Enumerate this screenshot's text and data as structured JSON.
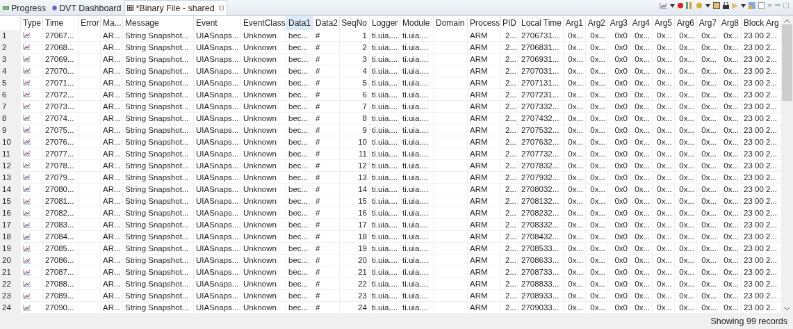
{
  "tabs": [
    {
      "label": "Progress",
      "selected": false,
      "kind": "progress"
    },
    {
      "label": "DVT Dashboard",
      "selected": false,
      "kind": "dashboard"
    },
    {
      "label": "*Binary File - shared",
      "selected": true,
      "kind": "table",
      "closable": true
    }
  ],
  "table": {
    "columns": [
      {
        "sorted": false
      },
      {
        "label": "Type",
        "sorted": false
      },
      {
        "label": "Time",
        "sorted": false
      },
      {
        "label": "Error",
        "sorted": false
      },
      {
        "label": "Ma...",
        "sorted": false
      },
      {
        "label": "Message",
        "sorted": false
      },
      {
        "label": "Event",
        "sorted": false
      },
      {
        "label": "EventClass",
        "sorted": false
      },
      {
        "label": "Data1",
        "sorted": true
      },
      {
        "label": "Data2",
        "sorted": false
      },
      {
        "label": "SeqNo",
        "sorted": false
      },
      {
        "label": "Logger",
        "sorted": false
      },
      {
        "label": "Module",
        "sorted": false
      },
      {
        "label": "Domain",
        "sorted": false
      },
      {
        "label": "Process",
        "sorted": false
      },
      {
        "label": "PID",
        "sorted": false
      },
      {
        "label": "Local Time",
        "sorted": false
      },
      {
        "label": "Arg1",
        "sorted": false
      },
      {
        "label": "Arg2",
        "sorted": false
      },
      {
        "label": "Arg3",
        "sorted": false
      },
      {
        "label": "Arg4",
        "sorted": false
      },
      {
        "label": "Arg5",
        "sorted": false
      },
      {
        "label": "Arg6",
        "sorted": false
      },
      {
        "label": "Arg7",
        "sorted": false
      },
      {
        "label": "Arg8",
        "sorted": false
      },
      {
        "label": "Block Arg",
        "sorted": false
      }
    ],
    "rows": [
      {
        "cells": [
          "1",
          "",
          "27067...",
          "",
          "AR...",
          "String Snapshot...",
          "UIASnaps...",
          "Unknown",
          "bec...",
          "#",
          "1",
          "ti.uia....",
          "ti.uia....",
          "",
          "ARM",
          "2...",
          "2706731...",
          "0x...",
          "0x...",
          "0x0",
          "0x...",
          "0x...",
          "0x...",
          "0x...",
          "0x...",
          "23 00 2..."
        ]
      },
      {
        "cells": [
          "2",
          "",
          "27068...",
          "",
          "AR...",
          "String Snapshot...",
          "UIASnaps...",
          "Unknown",
          "bec...",
          "#",
          "2",
          "ti.uia....",
          "ti.uia....",
          "",
          "ARM",
          "2...",
          "2706831...",
          "0x...",
          "0x...",
          "0x0",
          "0x...",
          "0x...",
          "0x...",
          "0x...",
          "0x...",
          "23 00 2..."
        ]
      },
      {
        "cells": [
          "3",
          "",
          "27069...",
          "",
          "AR...",
          "String Snapshot...",
          "UIASnaps...",
          "Unknown",
          "bec...",
          "#",
          "3",
          "ti.uia....",
          "ti.uia....",
          "",
          "ARM",
          "2...",
          "2706931...",
          "0x...",
          "0x...",
          "0x0",
          "0x...",
          "0x...",
          "0x...",
          "0x...",
          "0x...",
          "23 00 2..."
        ]
      },
      {
        "cells": [
          "4",
          "",
          "27070...",
          "",
          "AR...",
          "String Snapshot...",
          "UIASnaps...",
          "Unknown",
          "bec...",
          "#",
          "4",
          "ti.uia....",
          "ti.uia....",
          "",
          "ARM",
          "2...",
          "2707031...",
          "0x...",
          "0x...",
          "0x0",
          "0x...",
          "0x...",
          "0x...",
          "0x...",
          "0x...",
          "23 00 2..."
        ]
      },
      {
        "cells": [
          "5",
          "",
          "27071...",
          "",
          "AR...",
          "String Snapshot...",
          "UIASnaps...",
          "Unknown",
          "bec...",
          "#",
          "5",
          "ti.uia....",
          "ti.uia....",
          "",
          "ARM",
          "2...",
          "2707131...",
          "0x...",
          "0x...",
          "0x0",
          "0x...",
          "0x...",
          "0x...",
          "0x...",
          "0x...",
          "23 00 2..."
        ]
      },
      {
        "cells": [
          "6",
          "",
          "27072...",
          "",
          "AR...",
          "String Snapshot...",
          "UIASnaps...",
          "Unknown",
          "bec...",
          "#",
          "6",
          "ti.uia....",
          "ti.uia....",
          "",
          "ARM",
          "2...",
          "2707231...",
          "0x...",
          "0x...",
          "0x0",
          "0x...",
          "0x...",
          "0x...",
          "0x...",
          "0x...",
          "23 00 2..."
        ]
      },
      {
        "cells": [
          "7",
          "",
          "27073...",
          "",
          "AR...",
          "String Snapshot...",
          "UIASnaps...",
          "Unknown",
          "bec...",
          "#",
          "7",
          "ti.uia....",
          "ti.uia....",
          "",
          "ARM",
          "2...",
          "2707332...",
          "0x...",
          "0x...",
          "0x0",
          "0x...",
          "0x...",
          "0x...",
          "0x...",
          "0x...",
          "23 00 2..."
        ]
      },
      {
        "cells": [
          "8",
          "",
          "27074...",
          "",
          "AR...",
          "String Snapshot...",
          "UIASnaps...",
          "Unknown",
          "bec...",
          "#",
          "8",
          "ti.uia....",
          "ti.uia....",
          "",
          "ARM",
          "2...",
          "2707432...",
          "0x...",
          "0x...",
          "0x0",
          "0x...",
          "0x...",
          "0x...",
          "0x...",
          "0x...",
          "23 00 2..."
        ]
      },
      {
        "cells": [
          "9",
          "",
          "27075...",
          "",
          "AR...",
          "String Snapshot...",
          "UIASnaps...",
          "Unknown",
          "bec...",
          "#",
          "9",
          "ti.uia....",
          "ti.uia....",
          "",
          "ARM",
          "2...",
          "2707532...",
          "0x...",
          "0x...",
          "0x0",
          "0x...",
          "0x...",
          "0x...",
          "0x...",
          "0x...",
          "23 00 2..."
        ]
      },
      {
        "cells": [
          "10",
          "",
          "27076...",
          "",
          "AR...",
          "String Snapshot...",
          "UIASnaps...",
          "Unknown",
          "bec...",
          "#",
          "10",
          "ti.uia....",
          "ti.uia....",
          "",
          "ARM",
          "2...",
          "2707632...",
          "0x...",
          "0x...",
          "0x0",
          "0x...",
          "0x...",
          "0x...",
          "0x...",
          "0x...",
          "23 00 2..."
        ]
      },
      {
        "cells": [
          "11",
          "",
          "27077...",
          "",
          "AR...",
          "String Snapshot...",
          "UIASnaps...",
          "Unknown",
          "bec...",
          "#",
          "11",
          "ti.uia....",
          "ti.uia....",
          "",
          "ARM",
          "2...",
          "2707732...",
          "0x...",
          "0x...",
          "0x0",
          "0x...",
          "0x...",
          "0x...",
          "0x...",
          "0x...",
          "23 00 2..."
        ]
      },
      {
        "cells": [
          "12",
          "",
          "27078...",
          "",
          "AR...",
          "String Snapshot...",
          "UIASnaps...",
          "Unknown",
          "bec...",
          "#",
          "12",
          "ti.uia....",
          "ti.uia....",
          "",
          "ARM",
          "2...",
          "2707832...",
          "0x...",
          "0x...",
          "0x0",
          "0x...",
          "0x...",
          "0x...",
          "0x...",
          "0x...",
          "23 00 2..."
        ]
      },
      {
        "cells": [
          "13",
          "",
          "27079...",
          "",
          "AR...",
          "String Snapshot...",
          "UIASnaps...",
          "Unknown",
          "bec...",
          "#",
          "13",
          "ti.uia....",
          "ti.uia....",
          "",
          "ARM",
          "2...",
          "2707932...",
          "0x...",
          "0x...",
          "0x0",
          "0x...",
          "0x...",
          "0x...",
          "0x...",
          "0x...",
          "23 00 2..."
        ]
      },
      {
        "cells": [
          "14",
          "",
          "27080...",
          "",
          "AR...",
          "String Snapshot...",
          "UIASnaps...",
          "Unknown",
          "bec...",
          "#",
          "14",
          "ti.uia....",
          "ti.uia....",
          "",
          "ARM",
          "2...",
          "2708032...",
          "0x...",
          "0x...",
          "0x0",
          "0x...",
          "0x...",
          "0x...",
          "0x...",
          "0x...",
          "23 00 2..."
        ]
      },
      {
        "cells": [
          "15",
          "",
          "27081...",
          "",
          "AR...",
          "String Snapshot...",
          "UIASnaps...",
          "Unknown",
          "bec...",
          "#",
          "15",
          "ti.uia....",
          "ti.uia....",
          "",
          "ARM",
          "2...",
          "2708132...",
          "0x...",
          "0x...",
          "0x0",
          "0x...",
          "0x...",
          "0x...",
          "0x...",
          "0x...",
          "23 00 2..."
        ]
      },
      {
        "cells": [
          "16",
          "",
          "27082...",
          "",
          "AR...",
          "String Snapshot...",
          "UIASnaps...",
          "Unknown",
          "bec...",
          "#",
          "16",
          "ti.uia....",
          "ti.uia....",
          "",
          "ARM",
          "2...",
          "2708232...",
          "0x...",
          "0x...",
          "0x0",
          "0x...",
          "0x...",
          "0x...",
          "0x...",
          "0x...",
          "23 00 2..."
        ]
      },
      {
        "cells": [
          "17",
          "",
          "27083...",
          "",
          "AR...",
          "String Snapshot...",
          "UIASnaps...",
          "Unknown",
          "bec...",
          "#",
          "17",
          "ti.uia....",
          "ti.uia....",
          "",
          "ARM",
          "2...",
          "2708332...",
          "0x...",
          "0x...",
          "0x0",
          "0x...",
          "0x...",
          "0x...",
          "0x...",
          "0x...",
          "23 00 2..."
        ]
      },
      {
        "cells": [
          "18",
          "",
          "27084...",
          "",
          "AR...",
          "String Snapshot...",
          "UIASnaps...",
          "Unknown",
          "bec...",
          "#",
          "18",
          "ti.uia....",
          "ti.uia....",
          "",
          "ARM",
          "2...",
          "2708432...",
          "0x...",
          "0x...",
          "0x0",
          "0x...",
          "0x...",
          "0x...",
          "0x...",
          "0x...",
          "23 00 2..."
        ]
      },
      {
        "cells": [
          "19",
          "",
          "27085...",
          "",
          "AR...",
          "String Snapshot...",
          "UIASnaps...",
          "Unknown",
          "bec...",
          "#",
          "19",
          "ti.uia....",
          "ti.uia....",
          "",
          "ARM",
          "2...",
          "2708533...",
          "0x...",
          "0x...",
          "0x0",
          "0x...",
          "0x...",
          "0x...",
          "0x...",
          "0x...",
          "23 00 2..."
        ]
      },
      {
        "cells": [
          "20",
          "",
          "27086...",
          "",
          "AR...",
          "String Snapshot...",
          "UIASnaps...",
          "Unknown",
          "bec...",
          "#",
          "20",
          "ti.uia....",
          "ti.uia....",
          "",
          "ARM",
          "2...",
          "2708633...",
          "0x...",
          "0x...",
          "0x0",
          "0x...",
          "0x...",
          "0x...",
          "0x...",
          "0x...",
          "23 00 2..."
        ]
      },
      {
        "cells": [
          "21",
          "",
          "27087...",
          "",
          "AR...",
          "String Snapshot...",
          "UIASnaps...",
          "Unknown",
          "bec...",
          "#",
          "21",
          "ti.uia....",
          "ti.uia....",
          "",
          "ARM",
          "2...",
          "2708733...",
          "0x...",
          "0x...",
          "0x0",
          "0x...",
          "0x...",
          "0x...",
          "0x...",
          "0x...",
          "23 00 2..."
        ]
      },
      {
        "cells": [
          "22",
          "",
          "27088...",
          "",
          "AR...",
          "String Snapshot...",
          "UIASnaps...",
          "Unknown",
          "bec...",
          "#",
          "22",
          "ti.uia....",
          "ti.uia....",
          "",
          "ARM",
          "2...",
          "2708833...",
          "0x...",
          "0x...",
          "0x0",
          "0x...",
          "0x...",
          "0x...",
          "0x...",
          "0x...",
          "23 00 2..."
        ]
      },
      {
        "cells": [
          "23",
          "",
          "27089...",
          "",
          "AR...",
          "String Snapshot...",
          "UIASnaps...",
          "Unknown",
          "bec...",
          "#",
          "23",
          "ti.uia....",
          "ti.uia....",
          "",
          "ARM",
          "2...",
          "2708933...",
          "0x...",
          "0x...",
          "0x0",
          "0x...",
          "0x...",
          "0x...",
          "0x...",
          "0x...",
          "23 00 2..."
        ]
      },
      {
        "cells": [
          "24",
          "",
          "27090...",
          "",
          "AR...",
          "String Snapshot...",
          "UIASnaps...",
          "Unknown",
          "bec...",
          "#",
          "24",
          "ti.uia....",
          "ti.uia....",
          "",
          "ARM",
          "2...",
          "2709033...",
          "0x...",
          "0x...",
          "0x0",
          "0x...",
          "0x...",
          "0x...",
          "0x...",
          "0x...",
          "23 00 2..."
        ]
      }
    ]
  },
  "status_bar": {
    "text": "Showing 99 records"
  }
}
